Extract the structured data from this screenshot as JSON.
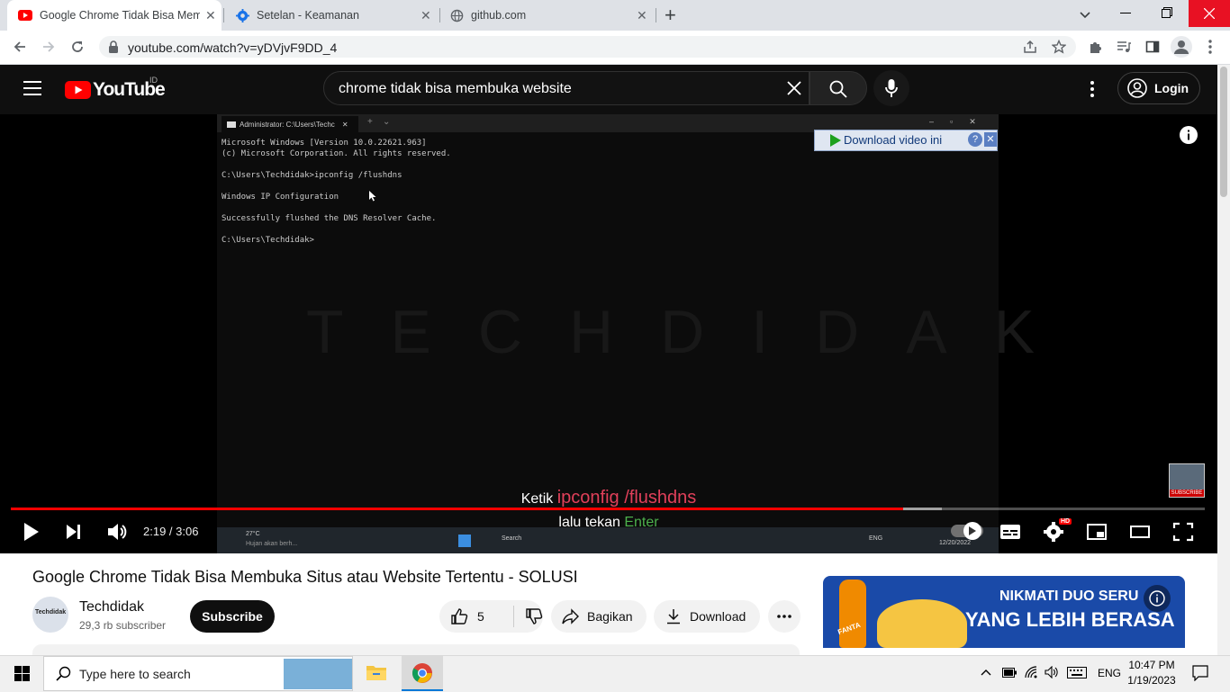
{
  "browser": {
    "tabs": [
      {
        "title": "Google Chrome Tidak Bisa Memb",
        "icon": "youtube-favicon",
        "active": true
      },
      {
        "title": "Setelan - Keamanan",
        "icon": "settings-gear-favicon",
        "active": false
      },
      {
        "title": "github.com",
        "icon": "globe-favicon",
        "active": false
      }
    ],
    "new_tab": "+",
    "url": "youtube.com/watch?v=yDVjvF9DD_4",
    "window_controls": [
      "minimize",
      "restore",
      "close"
    ]
  },
  "youtube": {
    "logo_text": "YouTube",
    "country_code": "ID",
    "search_query": "chrome tidak bisa membuka website",
    "login_label": "Login",
    "video": {
      "cmd_tab_title": "Administrator: C:\\Users\\Techc",
      "cmd_lines": [
        "Microsoft Windows [Version 10.0.22621.963]",
        "(c) Microsoft Corporation. All rights reserved.",
        "C:\\Users\\Techdidak>ipconfig /flushdns",
        "Windows IP Configuration",
        "Successfully flushed the DNS Resolver Cache.",
        "C:\\Users\\Techdidak>"
      ],
      "watermark": "TECHDIDAK",
      "download_label": "Download video ini",
      "subtitle_prefix": "Ketik ",
      "subtitle_command": "ipconfig /flushdns",
      "subtitle2_prefix": "lalu tekan ",
      "subtitle2_key": "Enter",
      "inner_taskbar": {
        "weather_temp": "27°C",
        "weather_text": "Hujan akan berh...",
        "search": "Search",
        "lang": "ENG",
        "date": "12/20/2022"
      },
      "subscribe_badge": "SUBSCRIBE"
    },
    "player": {
      "current_time": "2:19",
      "duration": "3:06",
      "time_display": "2:19 / 3:06",
      "progress_fraction": 0.747,
      "buffered_fraction": 0.78,
      "quality_badge": "HD"
    },
    "title": "Google Chrome Tidak Bisa Membuka Situs atau Website Tertentu - SOLUSI",
    "channel": {
      "name": "Techdidak",
      "subscribers": "29,3 rb subscriber",
      "avatar_text": "Techdidak"
    },
    "subscribe_label": "Subscribe",
    "actions": {
      "likes": "5",
      "share": "Bagikan",
      "download": "Download"
    },
    "ad": {
      "line1": "NIKMATI DUO SERU",
      "line2": "YANG LEBIH BERASA",
      "brand": "FANTA"
    },
    "colors": {
      "brand_red": "#ff0000",
      "header_bg": "#0f0f0f"
    }
  },
  "windows_taskbar": {
    "search_placeholder": "Type here to search",
    "lang": "ENG",
    "time": "10:47 PM",
    "date": "1/19/2023"
  }
}
